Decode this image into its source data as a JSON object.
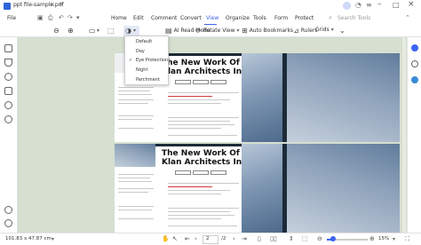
{
  "titlebar": {
    "tab_label": "ppt file-sample.pdf",
    "close_glyph": "×",
    "add_glyph": "+"
  },
  "menubar": {
    "items": [
      "File",
      "Home",
      "Edit",
      "Comment",
      "Convert",
      "View",
      "Organize",
      "Tools",
      "Form",
      "Protect"
    ],
    "active": "View",
    "search_placeholder": "Search Tools"
  },
  "toolbar": {
    "ai_read_mode": "AI Read Mode",
    "rotate_view": "Rotate View",
    "auto_bookmarks": "Auto Bookmarks",
    "rulers": "Rulers",
    "grids": "Grids"
  },
  "dropdown": {
    "items": [
      "Default",
      "Day",
      "Eye Protection",
      "Night",
      "Parchment"
    ],
    "selected": "Eye Protection"
  },
  "document": {
    "headline": [
      "The New Work Of",
      "Klan Architects Inc."
    ]
  },
  "statusbar": {
    "dimensions": "101.83 x 47.87 cm",
    "page_current": "2",
    "page_total": "/2",
    "zoom": "15%"
  },
  "colors": {
    "accent": "#3a63f0",
    "canvas_background": "#d6dfd0",
    "page_navy": "#1c2b38"
  }
}
